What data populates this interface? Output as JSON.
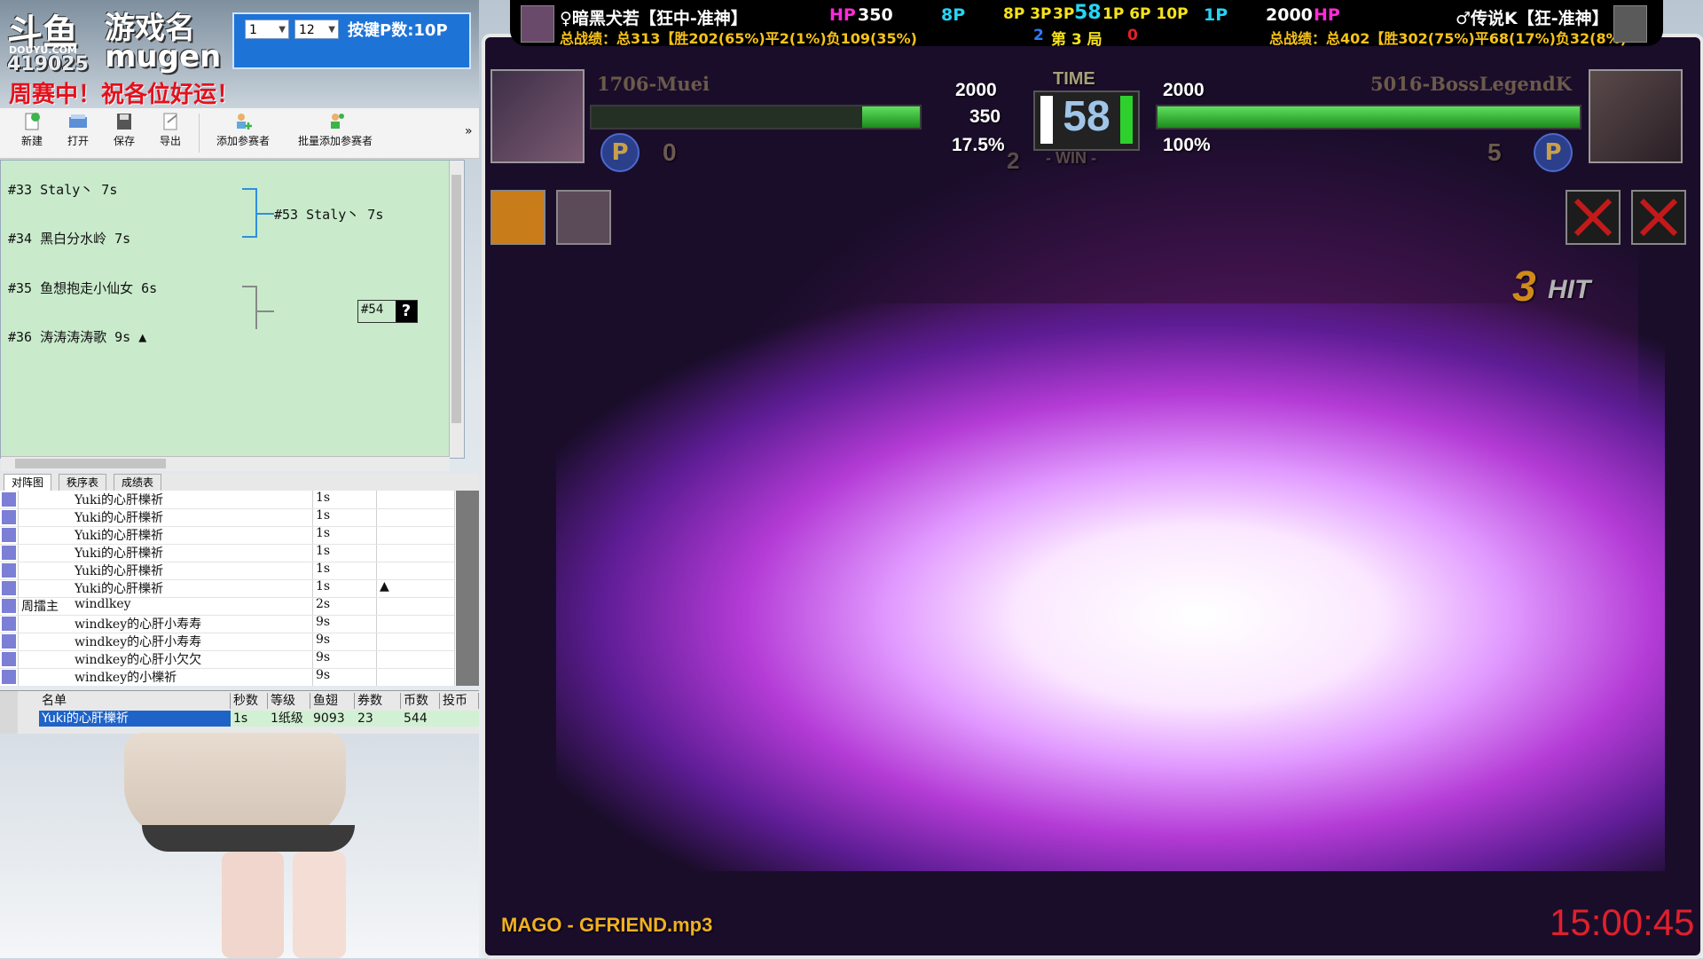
{
  "logo": {
    "site": "斗鱼",
    "site_sub": "DOUYU.COM",
    "room_id": "419025",
    "game_name": "游戏名",
    "game_title": "mugen",
    "banner": "周赛中！祝各位好运！"
  },
  "key_panel": {
    "select1": "1",
    "select2": "12",
    "label": "按键P数:10P"
  },
  "toolbar": {
    "new": "新建",
    "open": "打开",
    "save": "保存",
    "export": "导出",
    "add_player": "添加参赛者",
    "batch_add": "批量添加参赛者",
    "more": "»"
  },
  "bracket": {
    "entries": [
      "#33 Staly丶 7s",
      "#34 黑白分水岭 7s",
      "#35 鱼想抱走小仙女 6s",
      "#36 涛涛涛涛歌 9s ▲"
    ],
    "winner1": "#53 Staly丶 7s",
    "winner2": "#54",
    "unknown": "?"
  },
  "tabs": [
    "对阵图",
    "秩序表",
    "成绩表"
  ],
  "list_rows": [
    {
      "tag": "",
      "name": "Yuki的心肝櫟祈",
      "sec": "1s",
      "flag": ""
    },
    {
      "tag": "",
      "name": "Yuki的心肝櫟祈",
      "sec": "1s",
      "flag": ""
    },
    {
      "tag": "",
      "name": "Yuki的心肝櫟祈",
      "sec": "1s",
      "flag": ""
    },
    {
      "tag": "",
      "name": "Yuki的心肝櫟祈",
      "sec": "1s",
      "flag": ""
    },
    {
      "tag": "",
      "name": "Yuki的心肝櫟祈",
      "sec": "1s",
      "flag": ""
    },
    {
      "tag": "",
      "name": "Yuki的心肝櫟祈",
      "sec": "1s",
      "flag": "▲"
    },
    {
      "tag": "周擂主",
      "name": "windlkey",
      "sec": "2s",
      "flag": ""
    },
    {
      "tag": "",
      "name": "windkey的心肝小寿寿",
      "sec": "9s",
      "flag": ""
    },
    {
      "tag": "",
      "name": "windkey的心肝小寿寿",
      "sec": "9s",
      "flag": ""
    },
    {
      "tag": "",
      "name": "windkey的心肝小欠欠",
      "sec": "9s",
      "flag": ""
    },
    {
      "tag": "",
      "name": "windkey的小櫟祈",
      "sec": "9s",
      "flag": ""
    }
  ],
  "stat_table": {
    "headers": [
      "名单",
      "秒数",
      "等级",
      "鱼翅",
      "券数",
      "币数",
      "投币"
    ],
    "values": [
      "Yuki的心肝櫟祈",
      "1s",
      "1纸级",
      "9093",
      "23",
      "544",
      ""
    ]
  },
  "topbar": {
    "p1_name": "♀暗黑犬若【狂中-准神】",
    "p1_hp_label": "HP",
    "p1_hp": "350",
    "p1_pcount": "8P",
    "p1_record": "总战绩：总313【胜202(65%)平2(1%)负109(35%)",
    "mid_p_left": "8P 3P",
    "mid_p_hi": "3P",
    "mid_num": "58",
    "mid_p_right": "1P 6P 10P",
    "mid_round_pre": "2",
    "mid_round": "第 3 局",
    "mid_round_post": "0",
    "p2_pcount": "1P",
    "p2_hp": "2000",
    "p2_hp_label": "HP",
    "p2_name": "♂传说K【狂-准神】",
    "p2_record": "总战绩：总402【胜302(75%)平68(17%)负32(8%)"
  },
  "hud": {
    "p1_label": "1706-Muei",
    "p1_max": "2000",
    "p1_hp": "350",
    "p1_hp_fraction": 0.175,
    "p1_pct": "17.5%",
    "p1_power": "0",
    "p1_wins": "2",
    "time_label": "TIME",
    "time_value": "58",
    "win_label": "- WIN -",
    "p2_label": "5016-BossLegendK",
    "p2_max": "2000",
    "p2_hp": "2000",
    "p2_hp_fraction": 1.0,
    "p2_pct": "100%",
    "p2_power": "5",
    "combo_num": "3",
    "combo_label": "HIT",
    "power_icon": "P"
  },
  "music": "MAGO - GFRIEND.mp3",
  "clock": "15:00:45",
  "colors": {
    "hp_green": "#2fbf2f",
    "clock_red": "#e0202c",
    "bracket_bg": "#c9ebcc",
    "hp_magenta": "#ff2bd6"
  }
}
